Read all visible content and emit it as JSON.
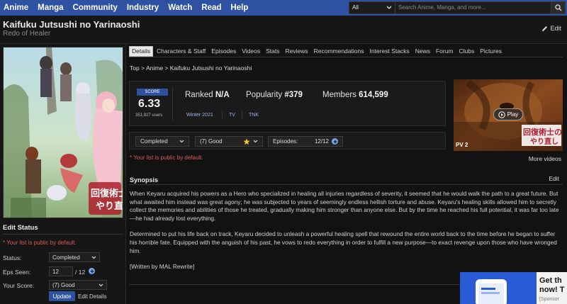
{
  "nav": {
    "items": [
      "Anime",
      "Manga",
      "Community",
      "Industry",
      "Watch",
      "Read",
      "Help"
    ],
    "search_filter": "All",
    "search_placeholder": "Search Anime, Manga, and more..."
  },
  "title": {
    "main": "Kaifuku Jutsushi no Yarinaoshi",
    "english": "Redo of Healer",
    "edit_label": "Edit"
  },
  "poster": {
    "logo_line1": "回復術士の",
    "logo_line2": "やり直し"
  },
  "edit_status": {
    "heading": "Edit Status",
    "public_note": "* Your list is public by default.",
    "status_label": "Status:",
    "status_value": "Completed",
    "eps_label": "Eps Seen:",
    "eps_value": "12",
    "eps_total": "/ 12",
    "score_label": "Your Score:",
    "score_value": "(7) Good",
    "update_label": "Update",
    "edit_details_label": "Edit Details"
  },
  "tabs": [
    "Details",
    "Characters & Staff",
    "Episodes",
    "Videos",
    "Stats",
    "Reviews",
    "Recommendations",
    "Interest Stacks",
    "News",
    "Forum",
    "Clubs",
    "Pictures"
  ],
  "breadcrumb": [
    "Top",
    "Anime",
    "Kaifuku Jutsushi no Yarinaoshi"
  ],
  "stats": {
    "score_label": "SCORE",
    "score": "6.33",
    "users": "351,927 users",
    "ranked_label": "Ranked",
    "ranked_value": "N/A",
    "popularity_label": "Popularity",
    "popularity_value": "#379",
    "members_label": "Members",
    "members_value": "614,599",
    "season": "Winter 2021",
    "type": "TV",
    "studio": "TNK"
  },
  "list_controls": {
    "status": "Completed",
    "score": "(7) Good",
    "episodes_label": "Episodes:",
    "episodes_value": "12/12",
    "public_note": "* Your list is public by default."
  },
  "video": {
    "play_label": "Play",
    "pv_label": "PV 2",
    "logo_text": "回復術士の",
    "logo_text2": "やり直し",
    "more_label": "More videos"
  },
  "synopsis": {
    "heading": "Synopsis",
    "edit_label": "Edit",
    "p1": "When Keyaru acquired his powers as a Hero who specialized in healing all injuries regardless of severity, it seemed that he would walk the path to a great future. But what awaited him instead was great agony; he was subjected to years of seemingly endless hellish torture and abuse. Keyaru's healing skills allowed him to secretly collect the memories and abilities of those he treated, gradually making him stronger than anyone else. But by the time he reached his full potential, it was far too late—he had already lost everything.",
    "p2": "Determined to put his life back on track, Keyaru decided to unleash a powerful healing spell that rewound the entire world back to the time before he began to suffer his horrible fate. Equipped with the anguish of his past, he vows to redo everything in order to fulfill a new purpose—to exact revenge upon those who have wronged him.",
    "credit": "[Written by MAL Rewrite]"
  },
  "ad": {
    "title_line1": "Get th",
    "title_line2": "now! T",
    "sponsor": "[Sponsor"
  }
}
